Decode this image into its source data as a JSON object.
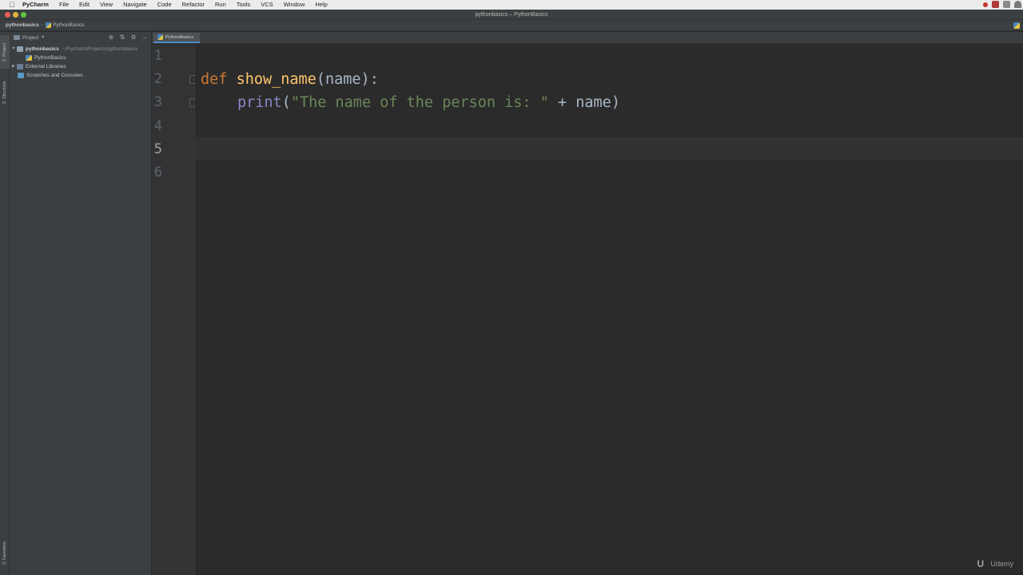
{
  "menubar": {
    "app_name": "PyCharm",
    "items": [
      "File",
      "Edit",
      "View",
      "Navigate",
      "Code",
      "Refactor",
      "Run",
      "Tools",
      "VCS",
      "Window",
      "Help"
    ]
  },
  "window": {
    "title": "pythonbasics – PythonBasics"
  },
  "navbar": {
    "project": "pythonbasics",
    "file": "PythonBasics"
  },
  "tool_strip": {
    "project_tab": "1: Project",
    "structure_tab": "2: Structure",
    "favorites_tab": "2: Favorites"
  },
  "project_panel": {
    "header": "Project",
    "tree": {
      "root_name": "pythonbasics",
      "root_path": "~/PycharmProjects/pythonbasics",
      "child_file": "PythonBasics",
      "external_libraries": "External Libraries",
      "scratches": "Scratches and Consoles"
    }
  },
  "editor": {
    "tab_label": "PythonBasics",
    "line_numbers": [
      "1",
      "2",
      "3",
      "4",
      "5",
      "6"
    ],
    "current_line": 5,
    "code": {
      "l2_kw": "def",
      "l2_fn": "show_name",
      "l2_rest": "(name):",
      "l3_builtin": "print",
      "l3_open": "(",
      "l3_string": "\"The name of the person is: \"",
      "l3_rest": " + name)"
    }
  },
  "watermark": {
    "text": "Udemy"
  },
  "colors": {
    "keyword": "#cc7832",
    "function": "#ffc66d",
    "builtin": "#8888c6",
    "string": "#6a8759",
    "default_text": "#a9b7c6",
    "editor_bg": "#2b2b2b"
  }
}
